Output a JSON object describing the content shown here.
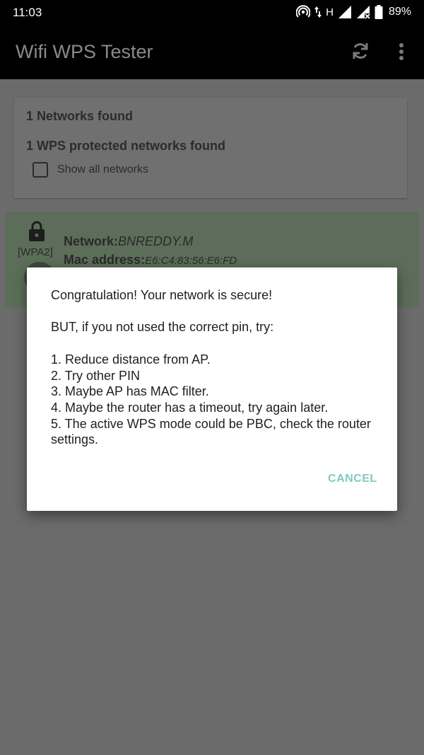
{
  "status_bar": {
    "time": "11:03",
    "battery": "89%",
    "icons": [
      "hotspot-icon",
      "data-arrows-icon",
      "signal-icon",
      "signal-no-data-icon",
      "battery-icon"
    ],
    "network_type": "H"
  },
  "app_bar": {
    "title": "Wifi WPS Tester",
    "actions": [
      "refresh-icon",
      "overflow-menu-icon"
    ]
  },
  "summary": {
    "networks_found": "1 Networks found",
    "wps_found": "1 WPS protected networks found",
    "show_all_label": "Show all networks",
    "show_all_checked": false
  },
  "network": {
    "encryption": "[WPA2]",
    "name_label": "Network:",
    "name_value": "BNREDDY.M",
    "mac_label": "Mac address:",
    "mac_value": "E6:C4:83:56:E6:FD"
  },
  "dialog": {
    "message": "Congratulation! Your network is secure!\n\nBUT, if you not used the correct pin, try:\n\n1. Reduce distance from AP.\n2. Try other PIN\n3. Maybe AP has MAC filter.\n4. Maybe the router has a timeout, try again later.\n5. The active WPS mode could be PBC, check the router settings.",
    "cancel_label": "CANCEL"
  },
  "colors": {
    "scrim": "#6b6b6b",
    "app_bar": "#000000",
    "dialog_background": "#ffffff",
    "accent": "#80cbc4",
    "network_card": "#5c6e59"
  }
}
